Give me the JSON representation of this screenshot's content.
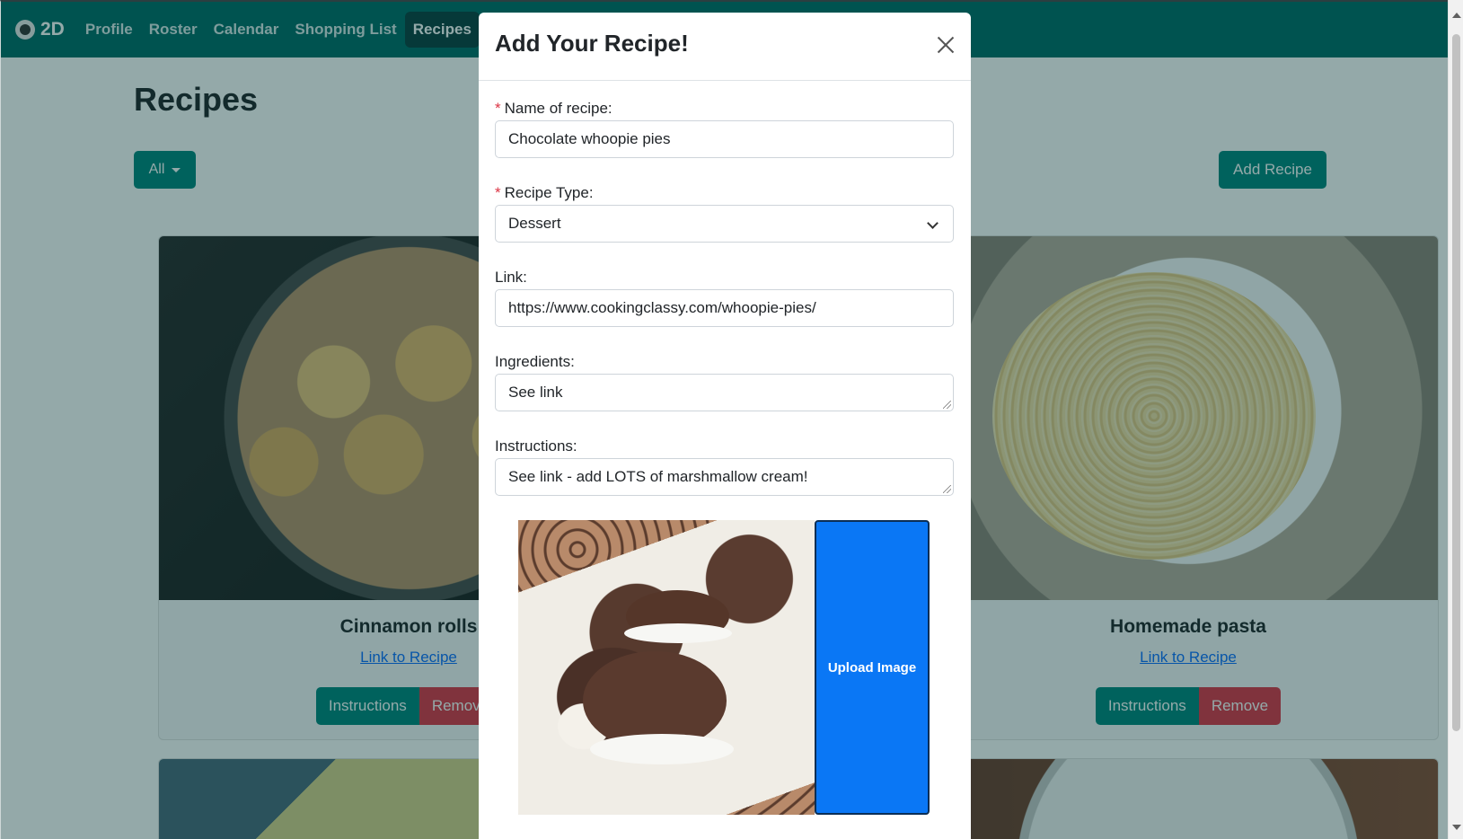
{
  "nav": {
    "brand": "2D",
    "items": [
      "Profile",
      "Roster",
      "Calendar",
      "Shopping List",
      "Recipes"
    ]
  },
  "page": {
    "title": "Recipes",
    "filter_label": "All",
    "add_button": "Add Recipe"
  },
  "cards": [
    {
      "title": "Cinnamon rolls",
      "link": "Link to Recipe",
      "instructions": "Instructions",
      "remove": "Remove"
    },
    {
      "title": "Homemade pasta",
      "link": "Link to Recipe",
      "instructions": "Instructions",
      "remove": "Remove"
    }
  ],
  "modal": {
    "title": "Add Your Recipe!",
    "required_mark": "*",
    "name_label": "Name of recipe:",
    "name_value": "Chocolate whoopie pies",
    "type_label": "Recipe Type:",
    "type_value": "Dessert",
    "link_label": "Link:",
    "link_value": "https://www.cookingclassy.com/whoopie-pies/",
    "ingredients_label": "Ingredients:",
    "ingredients_value": "See link",
    "instructions_label": "Instructions:",
    "instructions_value": "See link - add LOTS of marshmallow cream!",
    "upload_button": "Upload Image"
  },
  "colors": {
    "brand_teal": "#006b66",
    "button_teal": "#00857c",
    "danger_red": "#dc3545",
    "upload_blue": "#0a77f5"
  }
}
